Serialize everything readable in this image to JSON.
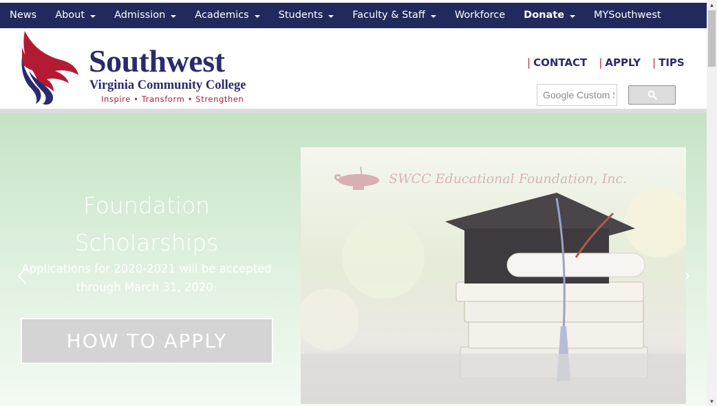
{
  "nav": {
    "items": [
      {
        "label": "News",
        "dropdown": false,
        "bold": false
      },
      {
        "label": "About",
        "dropdown": true,
        "bold": false
      },
      {
        "label": "Admission",
        "dropdown": true,
        "bold": false
      },
      {
        "label": "Academics",
        "dropdown": true,
        "bold": false
      },
      {
        "label": "Students",
        "dropdown": true,
        "bold": false
      },
      {
        "label": "Faculty & Staff",
        "dropdown": true,
        "bold": false
      },
      {
        "label": "Workforce",
        "dropdown": false,
        "bold": false
      },
      {
        "label": "Donate",
        "dropdown": true,
        "bold": true
      },
      {
        "label": "MYSouthwest",
        "dropdown": false,
        "bold": false
      }
    ],
    "background": "#212a5c"
  },
  "logo": {
    "name": "Southwest",
    "subtitle": "Virginia Community College",
    "tagline": "Inspire • Transform • Strengthen"
  },
  "quicklinks": [
    {
      "separator": "|",
      "label": "CONTACT"
    },
    {
      "separator": "|",
      "label": "APPLY"
    },
    {
      "separator": "|",
      "label": "TIPS"
    }
  ],
  "search": {
    "placeholder": "Google Custom Search",
    "button_icon": "search-icon"
  },
  "hero": {
    "title": "Foundation Scholarships",
    "text": "Applications for 2020-2021 will be accepted through March 31, 2020.",
    "button_label": "HOW TO APPLY",
    "image_caption": "SWCC Educational Foundation, Inc.",
    "prev_icon": "chevron-left-icon",
    "next_icon": "chevron-right-icon"
  },
  "colors": {
    "brand_navy": "#2b2a6e",
    "brand_red": "#a81d33",
    "hero_green": "#c5e2c6"
  }
}
